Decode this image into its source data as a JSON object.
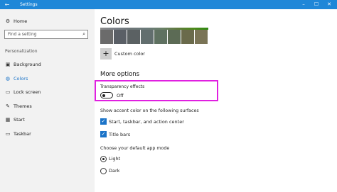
{
  "window": {
    "title": "Settings",
    "back_glyph": "←",
    "minimize_glyph": "–",
    "maximize_glyph": "☐",
    "close_glyph": "✕",
    "accent": "#1f87d8"
  },
  "sidebar": {
    "home_label": "Home",
    "search_placeholder": "Find a setting",
    "section_label": "Personalization",
    "items": [
      {
        "label": "Background",
        "icon": "picture-icon",
        "glyph": "▣"
      },
      {
        "label": "Colors",
        "icon": "palette-icon",
        "glyph": "◍",
        "active": true
      },
      {
        "label": "Lock screen",
        "icon": "monitor-icon",
        "glyph": "▭"
      },
      {
        "label": "Themes",
        "icon": "brush-icon",
        "glyph": "✎"
      },
      {
        "label": "Start",
        "icon": "start-grid-icon",
        "glyph": "▦"
      },
      {
        "label": "Taskbar",
        "icon": "taskbar-icon",
        "glyph": "▭"
      }
    ]
  },
  "main": {
    "title": "Colors",
    "swatch_colors": [
      "#6b6b6b",
      "#5a5f66",
      "#5b6163",
      "#626e6e",
      "#5f7161",
      "#5c6b55",
      "#6a6a4b",
      "#7a7456"
    ],
    "swatch_top_colors": [
      "#8a8a8a",
      "#7a8088",
      "#6d7678",
      "#6b7a7a",
      "#6a8068",
      "#5f7a3d",
      "#4e8a1c",
      "#2f8a12"
    ],
    "custom_color_label": "Custom color",
    "more_options_heading": "More options",
    "transparency_label": "Transparency effects",
    "transparency_state": "Off",
    "accent_surfaces_label": "Show accent color on the following surfaces",
    "checkbox_start": "Start, taskbar, and action center",
    "checkbox_titlebars": "Title bars",
    "app_mode_label": "Choose your default app mode",
    "mode_light": "Light",
    "mode_dark": "Dark",
    "highlight_color": "#e020e0"
  }
}
